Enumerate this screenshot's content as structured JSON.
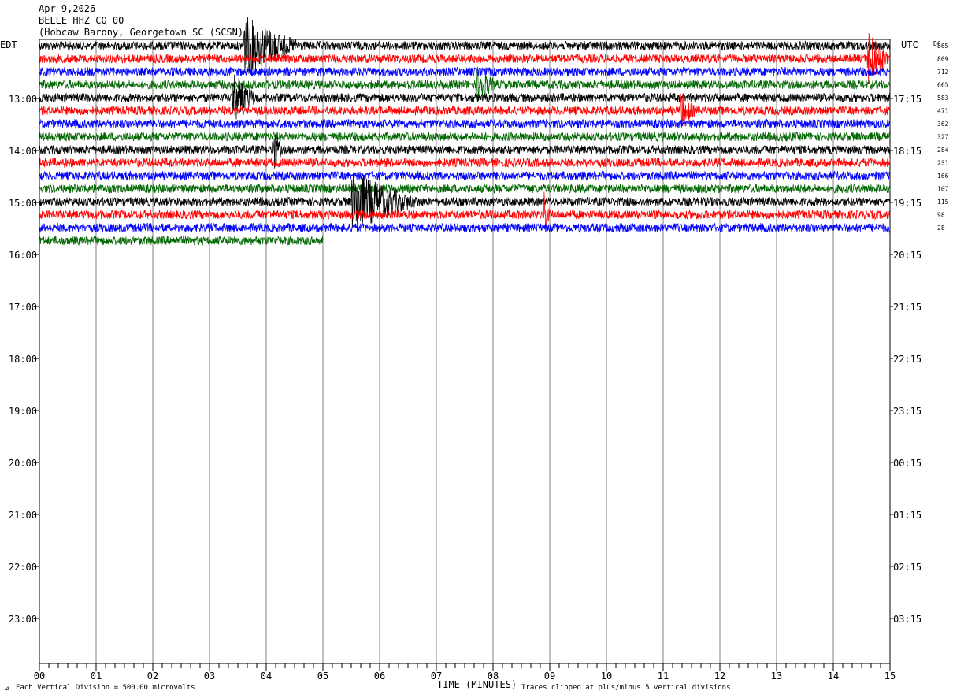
{
  "header": {
    "date": "Apr 9,2026",
    "station": "BELLE HHZ CO 00",
    "location": "(Hobcaw Barony, Georgetown SC (SCSN)"
  },
  "left_tz": "EDT",
  "right_tz": "UTC",
  "dc_label": "DC",
  "footer": {
    "scale_note": "Each Vertical Division =  500.00 microvolts",
    "clip_note": "Traces clipped at plus/minus 5 vertical divisions",
    "x_title": "TIME (MINUTES)"
  },
  "colors": {
    "black": "#000000",
    "red": "#ff0000",
    "blue": "#0000ff",
    "green": "#006600",
    "grid": "#808080"
  },
  "chart_data": {
    "type": "line",
    "title": "",
    "xlabel": "TIME (MINUTES)",
    "ylabel": "",
    "xlim": [
      0,
      15
    ],
    "x_ticks": [
      "00",
      "01",
      "02",
      "03",
      "04",
      "05",
      "06",
      "07",
      "08",
      "09",
      "10",
      "11",
      "12",
      "13",
      "14",
      "15"
    ],
    "left_hour_labels": [
      "13:00",
      "14:00",
      "15:00",
      "16:00",
      "17:00",
      "18:00",
      "19:00",
      "20:00",
      "21:00",
      "22:00",
      "23:00"
    ],
    "right_hour_labels": [
      "17:15",
      "18:15",
      "19:15",
      "20:15",
      "21:15",
      "22:15",
      "23:15",
      "00:15",
      "01:15",
      "02:15",
      "03:15"
    ],
    "dc_offsets": [
      "865",
      "809",
      "712",
      "665",
      "583",
      "471",
      "362",
      "327",
      "284",
      "231",
      "166",
      "107",
      "115",
      "98",
      "28"
    ],
    "trace_color_cycle": [
      "black",
      "red",
      "blue",
      "green"
    ],
    "traces_recorded": 16,
    "last_trace_end_minute": 5.0,
    "events": [
      {
        "trace": 0,
        "minute": 3.6,
        "duration_min": 1.1,
        "amplitude_div": 5
      },
      {
        "trace": 4,
        "minute": 3.4,
        "duration_min": 0.5,
        "amplitude_div": 4
      },
      {
        "trace": 5,
        "minute": 11.3,
        "duration_min": 0.3,
        "amplitude_div": 3
      },
      {
        "trace": 1,
        "minute": 14.6,
        "duration_min": 0.4,
        "amplitude_div": 5
      },
      {
        "trace": 3,
        "minute": 7.7,
        "duration_min": 0.4,
        "amplitude_div": 3
      },
      {
        "trace": 8,
        "minute": 4.1,
        "duration_min": 0.2,
        "amplitude_div": 4
      },
      {
        "trace": 12,
        "minute": 5.5,
        "duration_min": 1.3,
        "amplitude_div": 5
      },
      {
        "trace": 13,
        "minute": 8.9,
        "duration_min": 0.1,
        "amplitude_div": 4
      }
    ]
  }
}
